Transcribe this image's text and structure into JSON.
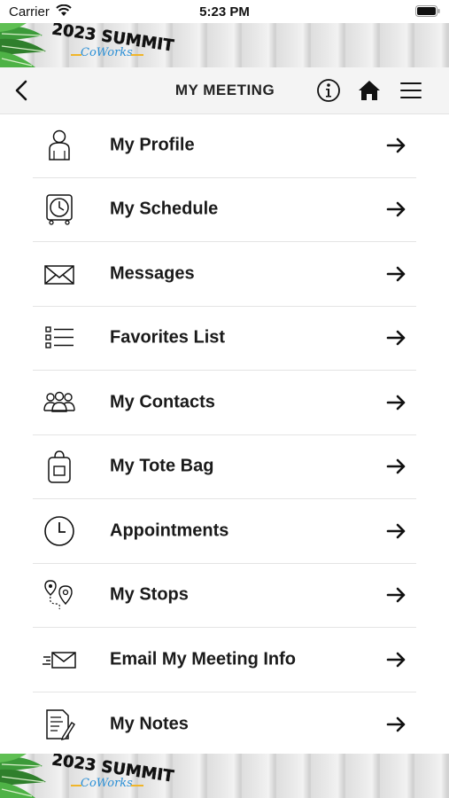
{
  "status_bar": {
    "carrier": "Carrier",
    "time": "5:23 PM"
  },
  "banner": {
    "logo_line1": "2023 SUMMIT",
    "logo_line2": "CoWorks"
  },
  "header": {
    "title": "MY MEETING"
  },
  "menu": {
    "items": [
      {
        "label": "My Profile",
        "icon": "person-icon"
      },
      {
        "label": "My Schedule",
        "icon": "alarm-clock-icon"
      },
      {
        "label": "Messages",
        "icon": "envelope-icon"
      },
      {
        "label": "Favorites List",
        "icon": "checklist-icon"
      },
      {
        "label": "My Contacts",
        "icon": "group-icon"
      },
      {
        "label": "My Tote Bag",
        "icon": "tote-bag-icon"
      },
      {
        "label": "Appointments",
        "icon": "clock-icon"
      },
      {
        "label": "My Stops",
        "icon": "map-pins-icon"
      },
      {
        "label": "Email My Meeting Info",
        "icon": "send-mail-icon"
      },
      {
        "label": "My Notes",
        "icon": "notes-icon"
      }
    ]
  }
}
